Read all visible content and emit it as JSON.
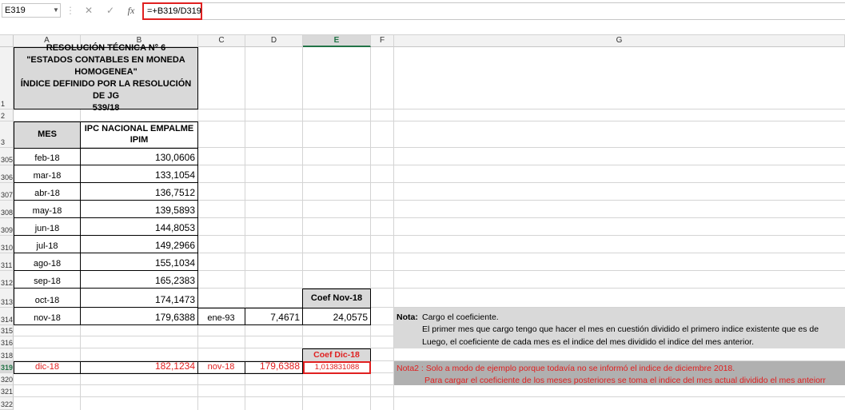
{
  "formula_bar": {
    "name_box": "E319",
    "formula": "=+B319/D319",
    "cancel_symbol": "✕",
    "enter_symbol": "✓",
    "fx_symbol": "fx"
  },
  "columns": [
    "A",
    "B",
    "C",
    "D",
    "E",
    "F",
    "G"
  ],
  "row_numbers": [
    "1",
    "2",
    "3",
    "305",
    "306",
    "307",
    "308",
    "309",
    "310",
    "311",
    "312",
    "313",
    "314",
    "315",
    "316",
    "318",
    "319",
    "320",
    "321",
    "322"
  ],
  "title": {
    "line1": "RESOLUCIÓN TÉCNICA N° 6",
    "line2": "\"ESTADOS CONTABLES EN MONEDA",
    "line3": "HOMOGENEA\"",
    "line4": "ÍNDICE DEFINIDO POR LA RESOLUCIÓN DE JG",
    "line5": "539/18"
  },
  "headers": {
    "mes": "MES",
    "ipc_line1": "IPC NACIONAL EMPALME",
    "ipc_line2": "IPIM"
  },
  "rows": [
    {
      "mes": "feb-18",
      "ipc": "130,0606"
    },
    {
      "mes": "mar-18",
      "ipc": "133,1054"
    },
    {
      "mes": "abr-18",
      "ipc": "136,7512"
    },
    {
      "mes": "may-18",
      "ipc": "139,5893"
    },
    {
      "mes": "jun-18",
      "ipc": "144,8053"
    },
    {
      "mes": "jul-18",
      "ipc": "149,2966"
    },
    {
      "mes": "ago-18",
      "ipc": "155,1034"
    },
    {
      "mes": "sep-18",
      "ipc": "165,2383"
    },
    {
      "mes": "oct-18",
      "ipc": "174,1473"
    }
  ],
  "row314": {
    "mes": "nov-18",
    "ipc": "179,6388",
    "base_mes": "ene-93",
    "base_ipc": "7,4671",
    "coef": "24,0575"
  },
  "coef_nov_label": "Coef Nov-18",
  "coef_dic_label": "Coef Dic-18",
  "row319": {
    "mes": "dic-18",
    "ipc": "182,1234",
    "prev_mes": "nov-18",
    "prev_ipc": "179,6388",
    "coef": "1,013831088"
  },
  "nota": {
    "label": "Nota:",
    "line1": "Cargo el coeficiente.",
    "line2": "El primer mes que cargo tengo que hacer el mes en cuestión dividido el primero indice existente que es de",
    "line3": "Luego, el coeficiente de cada mes es el indice del mes dividido el indice del mes anterior."
  },
  "nota2": {
    "line1": "Nota2 : Solo a modo de ejemplo porque todavía no se informó el indice de diciembre 2018.",
    "line2": "Para cargar el coeficiente de los meses posteriores se toma el indice del mes actual dividido el mes anteiorr"
  },
  "colors": {
    "accent_red": "#e02020",
    "header_grey": "#d9d9d9",
    "selected_green": "#217346",
    "note2_bg": "#b0b0b0"
  }
}
